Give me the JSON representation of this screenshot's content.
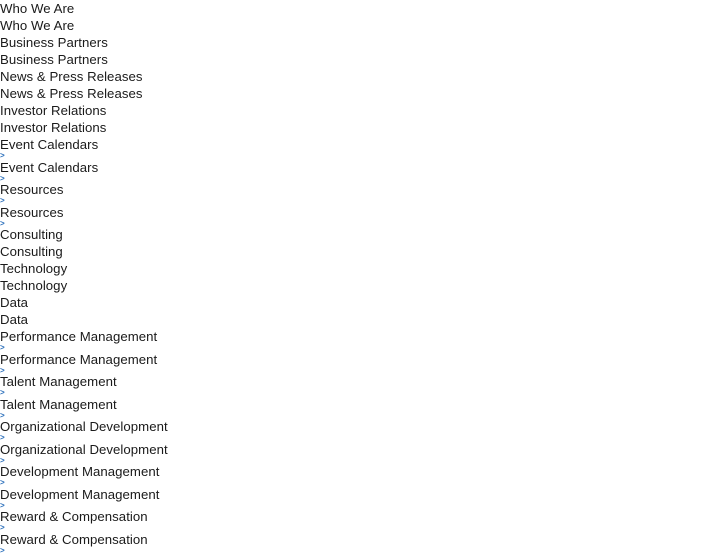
{
  "page": {
    "background_color": "#ffffff",
    "text_color": "#1a1a1a",
    "separator_color": "#2a6ebb",
    "separator_glyph": ">"
  },
  "nav": {
    "entries": [
      {
        "label": "Who We Are",
        "separator": ""
      },
      {
        "label": "Who We Are",
        "separator": ""
      },
      {
        "label": "Business Partners",
        "separator": ""
      },
      {
        "label": "Business Partners",
        "separator": ""
      },
      {
        "label": "News & Press Releases",
        "separator": ""
      },
      {
        "label": "News & Press Releases",
        "separator": ""
      },
      {
        "label": "Investor Relations",
        "separator": ""
      },
      {
        "label": "Investor Relations",
        "separator": ""
      },
      {
        "label": "Event Calendars",
        "separator": ">"
      },
      {
        "label": "Event Calendars",
        "separator": ">"
      },
      {
        "label": "Resources",
        "separator": ">"
      },
      {
        "label": "Resources",
        "separator": ">"
      },
      {
        "label": "Consulting",
        "separator": ""
      },
      {
        "label": "Consulting",
        "separator": ""
      },
      {
        "label": "Technology",
        "separator": ""
      },
      {
        "label": "Technology",
        "separator": ""
      },
      {
        "label": "Data",
        "separator": ""
      },
      {
        "label": "Data",
        "separator": ""
      },
      {
        "label": "Performance Management",
        "separator": ">"
      },
      {
        "label": "Performance Management",
        "separator": ">"
      },
      {
        "label": "Talent Management",
        "separator": ">"
      },
      {
        "label": "Talent Management",
        "separator": ">"
      },
      {
        "label": "Organizational Development",
        "separator": ">"
      },
      {
        "label": "Organizational Development",
        "separator": ">"
      },
      {
        "label": "Development Management",
        "separator": ">"
      },
      {
        "label": "Development Management",
        "separator": ">"
      },
      {
        "label": "Reward & Compensation",
        "separator": ">"
      },
      {
        "label": "Reward & Compensation",
        "separator": ">"
      }
    ]
  }
}
